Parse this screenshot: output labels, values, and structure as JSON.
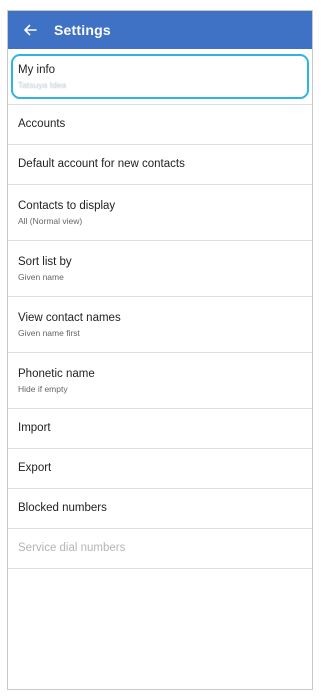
{
  "header": {
    "title": "Settings",
    "back_icon": "arrow-left-icon",
    "background_color": "#3f72c5"
  },
  "items": [
    {
      "label": "My info",
      "sub": "Tatsuya Idea"
    },
    {
      "label": "Accounts"
    },
    {
      "label": "Default account for new contacts"
    },
    {
      "label": "Contacts to display",
      "sub": "All (Normal view)"
    },
    {
      "label": "Sort list by",
      "sub": "Given name"
    },
    {
      "label": "View contact names",
      "sub": "Given name first"
    },
    {
      "label": "Phonetic name",
      "sub": "Hide if empty"
    },
    {
      "label": "Import"
    },
    {
      "label": "Export"
    },
    {
      "label": "Blocked numbers"
    },
    {
      "label": "Service dial numbers"
    }
  ],
  "highlight_color": "#2fb3e0"
}
